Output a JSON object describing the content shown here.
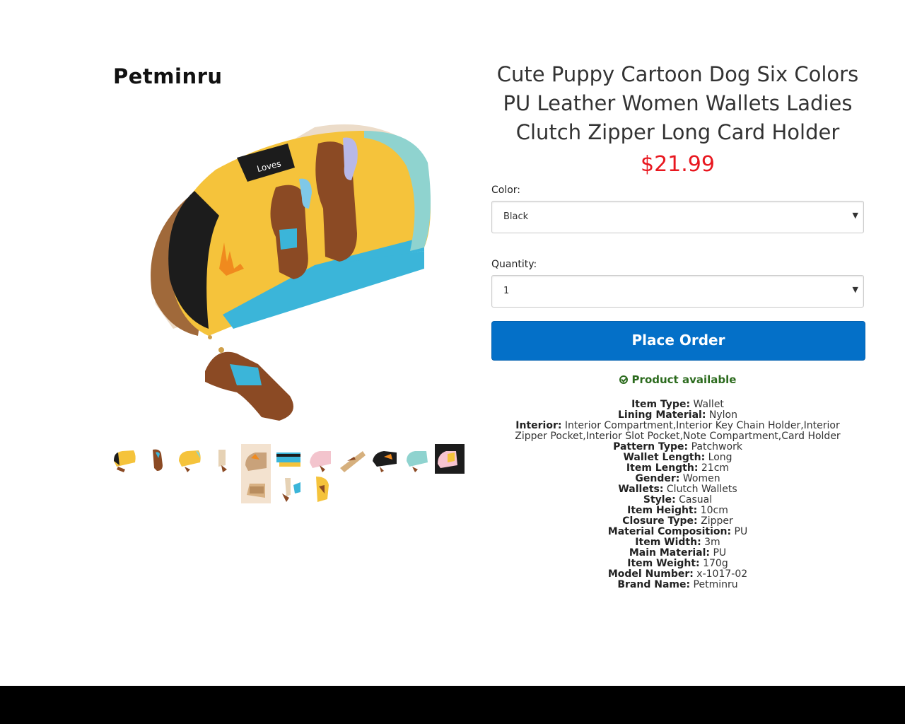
{
  "brand": {
    "logo_text": "Petminru"
  },
  "product": {
    "title": "Cute Puppy Cartoon Dog Six Colors PU Leather Women Wallets Ladies Clutch Zipper Long Card Holder",
    "price": "$21.99",
    "color_label": "Color:",
    "color_value": "Black",
    "quantity_label": "Quantity:",
    "quantity_value": "1",
    "order_button": "Place Order",
    "availability": "Product available"
  },
  "gallery": {
    "image_badge": "Loves",
    "thumbnail_count": 14
  },
  "specs": [
    {
      "key": "Item Type:",
      "value": " Wallet"
    },
    {
      "key": "Lining Material:",
      "value": " Nylon"
    },
    {
      "key": "Interior:",
      "value": " Interior Compartment,Interior Key Chain Holder,Interior Zipper Pocket,Interior Slot Pocket,Note Compartment,Card Holder"
    },
    {
      "key": "Pattern Type:",
      "value": " Patchwork"
    },
    {
      "key": "Wallet Length:",
      "value": " Long"
    },
    {
      "key": "Item Length:",
      "value": " 21cm"
    },
    {
      "key": "Gender:",
      "value": " Women"
    },
    {
      "key": "Wallets:",
      "value": " Clutch Wallets"
    },
    {
      "key": "Style:",
      "value": " Casual"
    },
    {
      "key": "Item Height:",
      "value": " 10cm"
    },
    {
      "key": "Closure Type:",
      "value": " Zipper"
    },
    {
      "key": "Material Composition:",
      "value": " PU"
    },
    {
      "key": "Item Width:",
      "value": " 3m"
    },
    {
      "key": "Main Material:",
      "value": " PU"
    },
    {
      "key": "Item Weight:",
      "value": " 170g"
    },
    {
      "key": "Model Number:",
      "value": " x-1017-02"
    },
    {
      "key": "Brand Name:",
      "value": " Petminru"
    }
  ],
  "colors": {
    "price": "#e8171f",
    "button": "#0470c8",
    "available": "#2c6b1e",
    "wallet_yellow": "#f5c33b",
    "wallet_teal": "#8fd3cf",
    "wallet_black": "#1c1c1c",
    "dog_brown": "#8b4a24"
  }
}
